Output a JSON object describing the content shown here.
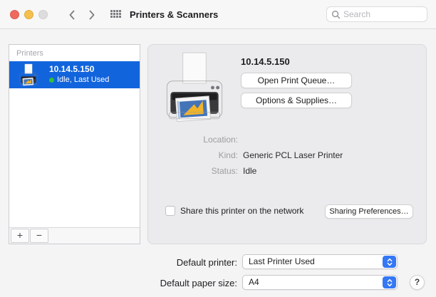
{
  "titlebar": {
    "title": "Printers & Scanners",
    "search_placeholder": "Search"
  },
  "sidebar": {
    "header": "Printers",
    "selected_printer": {
      "name": "10.14.5.150",
      "status": "Idle, Last Used"
    },
    "add_label": "+",
    "remove_label": "−"
  },
  "detail": {
    "printer_name": "10.14.5.150",
    "open_print_queue_label": "Open Print Queue…",
    "options_supplies_label": "Options & Supplies…",
    "location_label": "Location:",
    "location_value": "",
    "kind_label": "Kind:",
    "kind_value": "Generic PCL Laser Printer",
    "status_label": "Status:",
    "status_value": "Idle",
    "share_label": "Share this printer on the network",
    "share_checked": false,
    "sharing_preferences_label": "Sharing Preferences…"
  },
  "footer": {
    "default_printer_label": "Default printer:",
    "default_printer_value": "Last Printer Used",
    "default_paper_label": "Default paper size:",
    "default_paper_value": "A4",
    "help_label": "?"
  },
  "colors": {
    "selection_blue": "#1264dc",
    "stepper_blue": "#3478f6",
    "status_green": "#2ec234",
    "traffic_red": "#ee6a5e",
    "traffic_yellow": "#f5bf4e",
    "traffic_gray": "#dddddd"
  }
}
